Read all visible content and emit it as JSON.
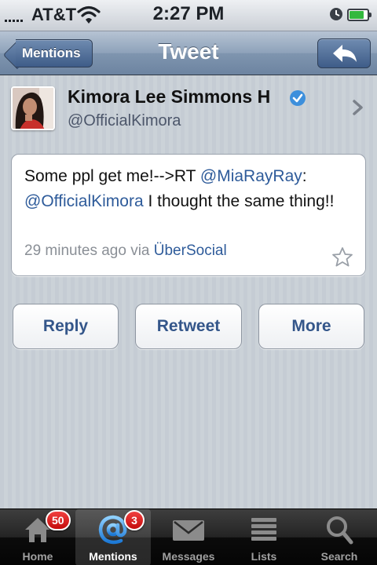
{
  "status_bar": {
    "carrier": "AT&T",
    "time": "2:27 PM",
    "battery_level": 0.8,
    "icons": [
      "signal-icon",
      "wifi-icon",
      "alarm-icon",
      "battery-icon"
    ]
  },
  "nav": {
    "back_label": "Mentions",
    "title": "Tweet",
    "action_icon": "reply-arrow-icon"
  },
  "profile": {
    "name": "Kimora Lee Simmons H",
    "handle": "@OfficialKimora",
    "verified_icon": "verified-badge-icon"
  },
  "tweet": {
    "text_part1": "Some ppl get me!-->RT ",
    "mention1": "@MiaRayRay",
    "text_part2": ": ",
    "mention2": "@OfficialKimora",
    "text_part3": " I thought the same thing!!",
    "time_ago": "29 minutes ago via ",
    "via_app": "ÜberSocial"
  },
  "actions": {
    "reply": "Reply",
    "retweet": "Retweet",
    "more": "More"
  },
  "tabs": [
    {
      "label": "Home",
      "icon": "home-icon",
      "badge": "50"
    },
    {
      "label": "Mentions",
      "icon": "at-icon",
      "badge": "3",
      "selected": true
    },
    {
      "label": "Messages",
      "icon": "envelope-icon"
    },
    {
      "label": "Lists",
      "icon": "list-icon"
    },
    {
      "label": "Search",
      "icon": "search-icon"
    }
  ],
  "colors": {
    "link": "#2e5b9a",
    "nav_bar": "#8ea2ba",
    "badge": "#d81e1e",
    "background": "#c5ccd4"
  }
}
